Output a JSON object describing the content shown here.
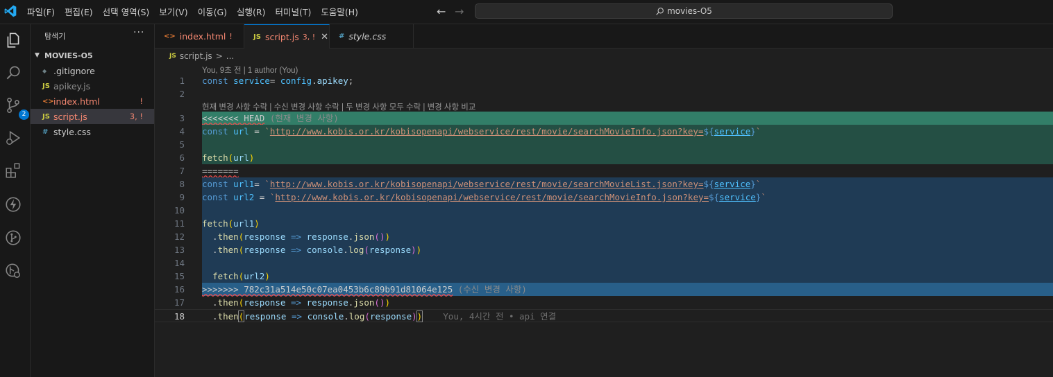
{
  "menu": [
    "파일(F)",
    "편집(E)",
    "선택 영역(S)",
    "보기(V)",
    "이동(G)",
    "실행(R)",
    "터미널(T)",
    "도움말(H)"
  ],
  "search": {
    "text": "movies-O5"
  },
  "colors": {
    "accent": "#0078d4",
    "error": "#f48771",
    "current_change": "#327e68",
    "incoming_change": "#285f89"
  },
  "activity": {
    "icons": [
      "explorer-icon",
      "search-icon",
      "source-control-icon",
      "run-debug-icon",
      "extensions-icon",
      "lightning-icon",
      "git-graph-icon",
      "remote-icon"
    ],
    "scm_badge": "2"
  },
  "sidebar": {
    "title": "탐색기",
    "more": "···",
    "folder": "MOVIES-O5",
    "files": [
      {
        "icon": "◆",
        "label": ".gitignore",
        "status": ""
      },
      {
        "icon": "JS",
        "label": "apikey.js",
        "status": ""
      },
      {
        "icon": "<>",
        "label": "index.html",
        "status": "!"
      },
      {
        "icon": "JS",
        "label": "script.js",
        "status": "3, !"
      },
      {
        "icon": "#",
        "label": "style.css",
        "status": ""
      }
    ]
  },
  "tabs": [
    {
      "icon": "<>",
      "label": "index.html",
      "status": "!"
    },
    {
      "icon": "JS",
      "label": "script.js",
      "status": "3, !",
      "close": "✕"
    },
    {
      "icon": "#",
      "label": "style.css",
      "status": ""
    }
  ],
  "breadcrumb": {
    "icon": "JS",
    "file": "script.js",
    "sep": ">",
    "rest": "..."
  },
  "editor": {
    "codelens_blame": "You, 9초 전 | 1 author (You)",
    "codelens_merge": "현재 변경 사항 수락 | 수신 변경 사항 수락 | 두 변경 사항 모두 수락 | 변경 사항 비교",
    "line_numbers": [
      "1",
      "2",
      "3",
      "4",
      "5",
      "6",
      "7",
      "8",
      "9",
      "10",
      "11",
      "12",
      "13",
      "14",
      "15",
      "16",
      "17",
      "18"
    ],
    "head_marker": "<<<<<<< HEAD",
    "head_label": "(현재 변경 사항)",
    "separator": "=======",
    "incoming_marker": ">>>>>>> 782c31a514e50c07ea0453b6c89b91d81064e125",
    "incoming_label": "(수신 변경 사항)",
    "url_info": "http://www.kobis.or.kr/kobisopenapi/webservice/rest/movie/searchMovieInfo.json?key=",
    "url_list": "http://www.kobis.or.kr/kobisopenapi/webservice/rest/movie/searchMovieList.json?key=",
    "inline_blame": "You, 4시간 전 • api 연결"
  }
}
